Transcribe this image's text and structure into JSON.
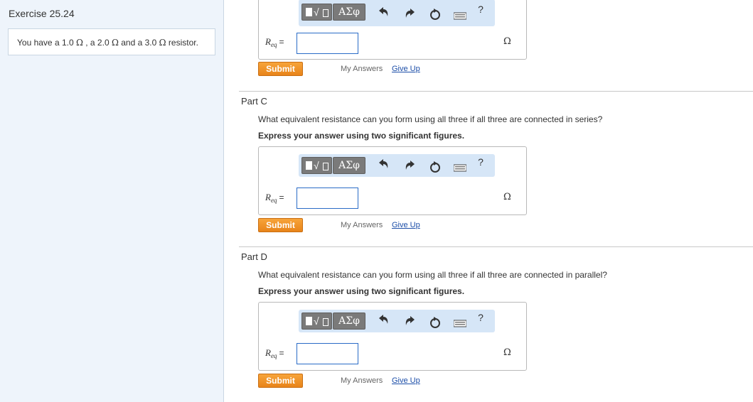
{
  "sidebar": {
    "exercise_title": "Exercise 25.24",
    "intro": {
      "part1": "You have a 1.0 ",
      "part2": " , a 2.0 ",
      "part3": " and a 3.0 ",
      "part4": " resistor.",
      "ohm_symbol": "Ω"
    }
  },
  "toolbar": {
    "greek_label": "ΑΣφ",
    "radical_label": "√",
    "help_label": "?"
  },
  "answer_field": {
    "var_symbol": "R",
    "var_subscript": "eq",
    "equals": "=",
    "unit": "Ω"
  },
  "actions": {
    "submit_label": "Submit",
    "my_answers_label": "My Answers",
    "give_up_label": "Give Up"
  },
  "parts": {
    "part_c": {
      "title": "Part C",
      "question": "What equivalent resistance can you form using all three if all three are connected in series?",
      "instruction": "Express your answer using two significant figures."
    },
    "part_d": {
      "title": "Part D",
      "question": "What equivalent resistance can you form using all three if all three are connected in parallel?",
      "instruction": "Express your answer using two significant figures."
    }
  },
  "icons": [
    "template-icon",
    "undo-icon",
    "redo-icon",
    "reset-icon",
    "keyboard-icon",
    "help-icon"
  ],
  "colors": {
    "sidebar_bg": "#eef4fb",
    "toolbar_bg": "#d6e6f7",
    "submit_orange": "#f29a2e",
    "link_blue": "#1c4ea8",
    "input_border": "#2a6bc7"
  }
}
